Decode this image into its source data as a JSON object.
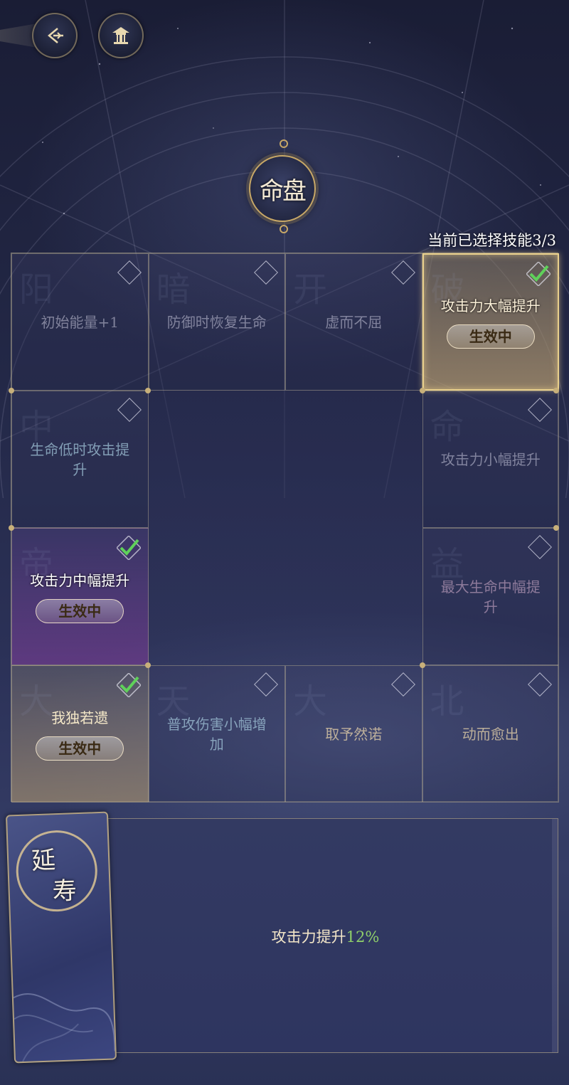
{
  "header": {
    "back_icon": "back-arrow-icon",
    "pavilion_icon": "pavilion-icon",
    "emblem_text": "命盘"
  },
  "selection": {
    "label": "当前已选择技能3/3"
  },
  "grid": {
    "cells": [
      {
        "name": "初始能量+1",
        "state": "inactive",
        "bg_char": "阳"
      },
      {
        "name": "防御时恢复生命",
        "state": "inactive",
        "bg_char": "暗"
      },
      {
        "name": "虚而不屈",
        "state": "inactive",
        "bg_char": "开"
      },
      {
        "name": "攻击力大幅提升",
        "state": "active",
        "badge": "生效中",
        "bg_char": "破"
      },
      {
        "name": "生命低时攻击提升",
        "state": "inactive",
        "bg_char": "中"
      },
      {
        "name": "攻击力小幅提升",
        "state": "inactive",
        "bg_char": "命"
      },
      {
        "name": "攻击力中幅提升",
        "state": "active",
        "badge": "生效中",
        "bg_char": "帝"
      },
      {
        "name": "最大生命中幅提升",
        "state": "inactive",
        "bg_char": "益"
      },
      {
        "name": "我独若遗",
        "state": "active",
        "badge": "生效中",
        "bg_char": "大"
      },
      {
        "name": "普攻伤害小幅增加",
        "state": "inactive",
        "bg_char": "天"
      },
      {
        "name": "取予然诺",
        "state": "inactive",
        "bg_char": "大"
      },
      {
        "name": "动而愈出",
        "state": "inactive",
        "bg_char": "北"
      }
    ]
  },
  "card": {
    "char1": "延",
    "char2": "寿"
  },
  "effect": {
    "prefix": "攻击力提升",
    "value": "12%",
    "value_color": "#8fcf6a"
  },
  "colors": {
    "accent_gold": "#c8a867",
    "check_green": "#5fd15a"
  }
}
